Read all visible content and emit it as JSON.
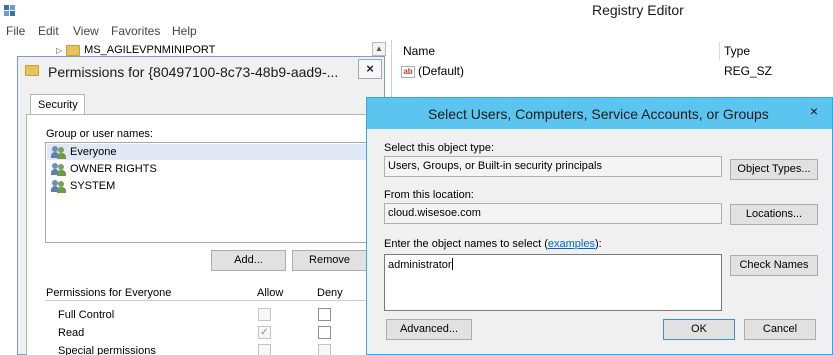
{
  "registry": {
    "title": "Registry Editor",
    "menu": [
      "File",
      "Edit",
      "View",
      "Favorites",
      "Help"
    ],
    "tree_item": "MS_AGILEVPNMINIPORT",
    "columns": {
      "name": "Name",
      "type": "Type"
    },
    "rows": [
      {
        "name": "(Default)",
        "type": "REG_SZ"
      }
    ]
  },
  "permissions_dialog": {
    "title": "Permissions for {80497100-8c73-48b9-aad9-...",
    "close": "×",
    "tab": "Security",
    "group_label": "Group or user names:",
    "groups": [
      "Everyone",
      "OWNER RIGHTS",
      "SYSTEM"
    ],
    "add_button": "Add...",
    "remove_button": "Remove",
    "permissions_for": "Permissions for Everyone",
    "allow_label": "Allow",
    "deny_label": "Deny",
    "permissions": [
      {
        "name": "Full Control",
        "allow": false,
        "deny": false
      },
      {
        "name": "Read",
        "allow": true,
        "deny": false
      },
      {
        "name": "Special permissions",
        "allow": false,
        "deny": false
      }
    ]
  },
  "select_dialog": {
    "title": "Select Users, Computers, Service Accounts, or Groups",
    "close": "×",
    "object_type_label": "Select this object type:",
    "object_type_value": "Users, Groups, or Built-in security principals",
    "object_types_button": "Object Types...",
    "location_label": "From this location:",
    "location_value": "cloud.wisesoe.com",
    "locations_button": "Locations...",
    "enter_label_prefix": "Enter the object names to select (",
    "enter_label_link": "examples",
    "enter_label_suffix": "):",
    "names_value": "administrator",
    "check_names_button": "Check Names",
    "advanced_button": "Advanced...",
    "ok_button": "OK",
    "cancel_button": "Cancel"
  },
  "colors": {
    "select_titlebar": "#5bc5f0",
    "link": "#0066cc",
    "folder": "#e8c25c"
  }
}
